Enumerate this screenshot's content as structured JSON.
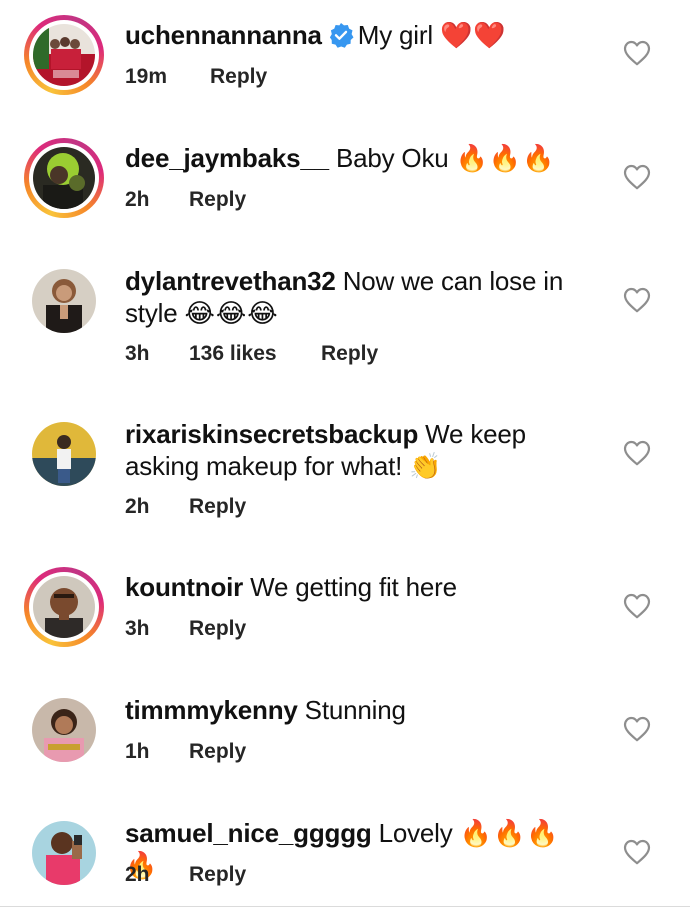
{
  "comments": [
    {
      "username": "uchennannanna",
      "verified": true,
      "text": "My girl",
      "emoji": "❤️❤️",
      "time": "19m",
      "likes": "",
      "reply": "Reply"
    },
    {
      "username": "dee_jaymbaks__",
      "verified": false,
      "text": "Baby Oku",
      "emoji": "🔥🔥🔥",
      "time": "2h",
      "likes": "",
      "reply": "Reply"
    },
    {
      "username": "dylantrevethan32",
      "verified": false,
      "text": "Now we can lose in style",
      "emoji": "😂😂😂",
      "time": "3h",
      "likes": "136 likes",
      "reply": "Reply"
    },
    {
      "username": "rixariskinsecretsbackup",
      "verified": false,
      "text": "We keep asking makeup for what!",
      "emoji": "👏",
      "time": "2h",
      "likes": "",
      "reply": "Reply"
    },
    {
      "username": "kountnoir",
      "verified": false,
      "text": "We getting fit here",
      "emoji": "",
      "time": "3h",
      "likes": "",
      "reply": "Reply"
    },
    {
      "username": "timmmykenny",
      "verified": false,
      "text": "Stunning",
      "emoji": "",
      "time": "1h",
      "likes": "",
      "reply": "Reply"
    },
    {
      "username": "samuel_nice_ggggg",
      "verified": false,
      "text": "Lovely",
      "emoji": "🔥🔥🔥🔥",
      "time": "2h",
      "likes": "",
      "reply": "Reply"
    }
  ],
  "icons": {
    "like": "heart-outline-icon",
    "verified": "verified-badge-icon"
  },
  "colors": {
    "verified_blue": "#3797f0",
    "story_ring_start": "#f9c33a",
    "story_ring_end": "#c13584",
    "meta_text": "#262626",
    "heart_outline": "#8e8e8e"
  }
}
